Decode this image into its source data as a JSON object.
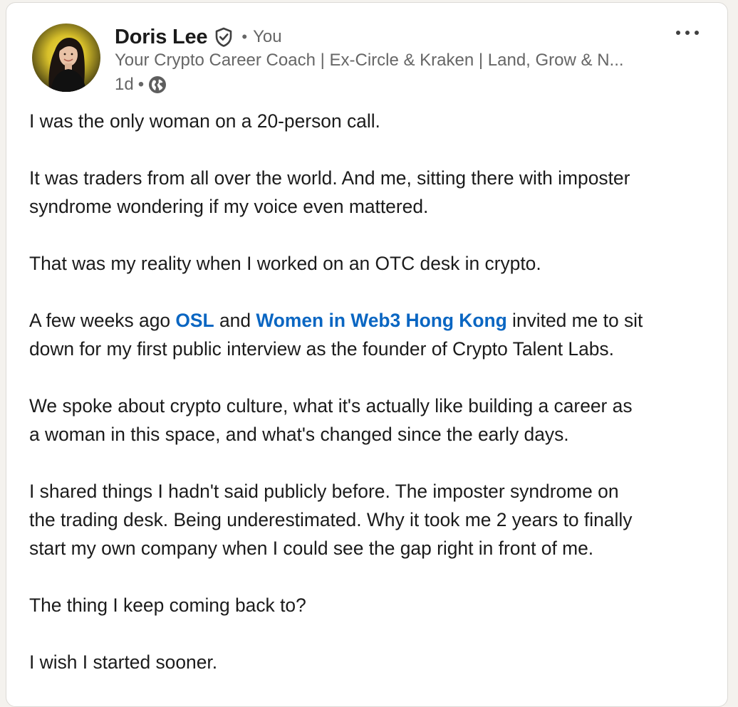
{
  "post": {
    "author": {
      "name": "Doris Lee",
      "connection": "You",
      "headline": "Your Crypto Career Coach | Ex-Circle & Kraken | Land, Grow & N...",
      "timestamp": "1d",
      "visibility_icon": "globe-icon",
      "verified_icon": "verified-shield-icon"
    },
    "menu_icon": "more-options-icon",
    "body": {
      "p1": "I was the only woman on a 20-person call.",
      "p2_line1": "It was traders from all over the world. And me, sitting there with imposter",
      "p2_line2": "syndrome wondering if my voice even mattered.",
      "p3": "That was my reality when I worked on an OTC desk in crypto.",
      "p4_pre": "A few weeks ago ",
      "p4_mention1": "OSL",
      "p4_mid": " and ",
      "p4_mention2": "Women in Web3 Hong Kong",
      "p4_post": " invited me to sit",
      "p4_line2": "down for my first public interview as the founder of Crypto Talent Labs.",
      "p5_line1": "We spoke about crypto culture, what it's actually like building a career as",
      "p5_line2": "a woman in this space, and what's changed since the early days.",
      "p6_line1": "I shared things I hadn't said publicly before. The imposter syndrome on",
      "p6_line2": "the trading desk. Being underestimated. Why it took me 2 years to finally",
      "p6_line3": "start my own company when I could see the gap right in front of me.",
      "p7": "The thing I keep coming back to?",
      "p8": "I wish I started sooner."
    }
  },
  "colors": {
    "link": "#0a66c2",
    "secondary_text": "#666666",
    "primary_text": "#1b1b1b",
    "card_background": "#ffffff",
    "page_background": "#f4f2ee"
  }
}
